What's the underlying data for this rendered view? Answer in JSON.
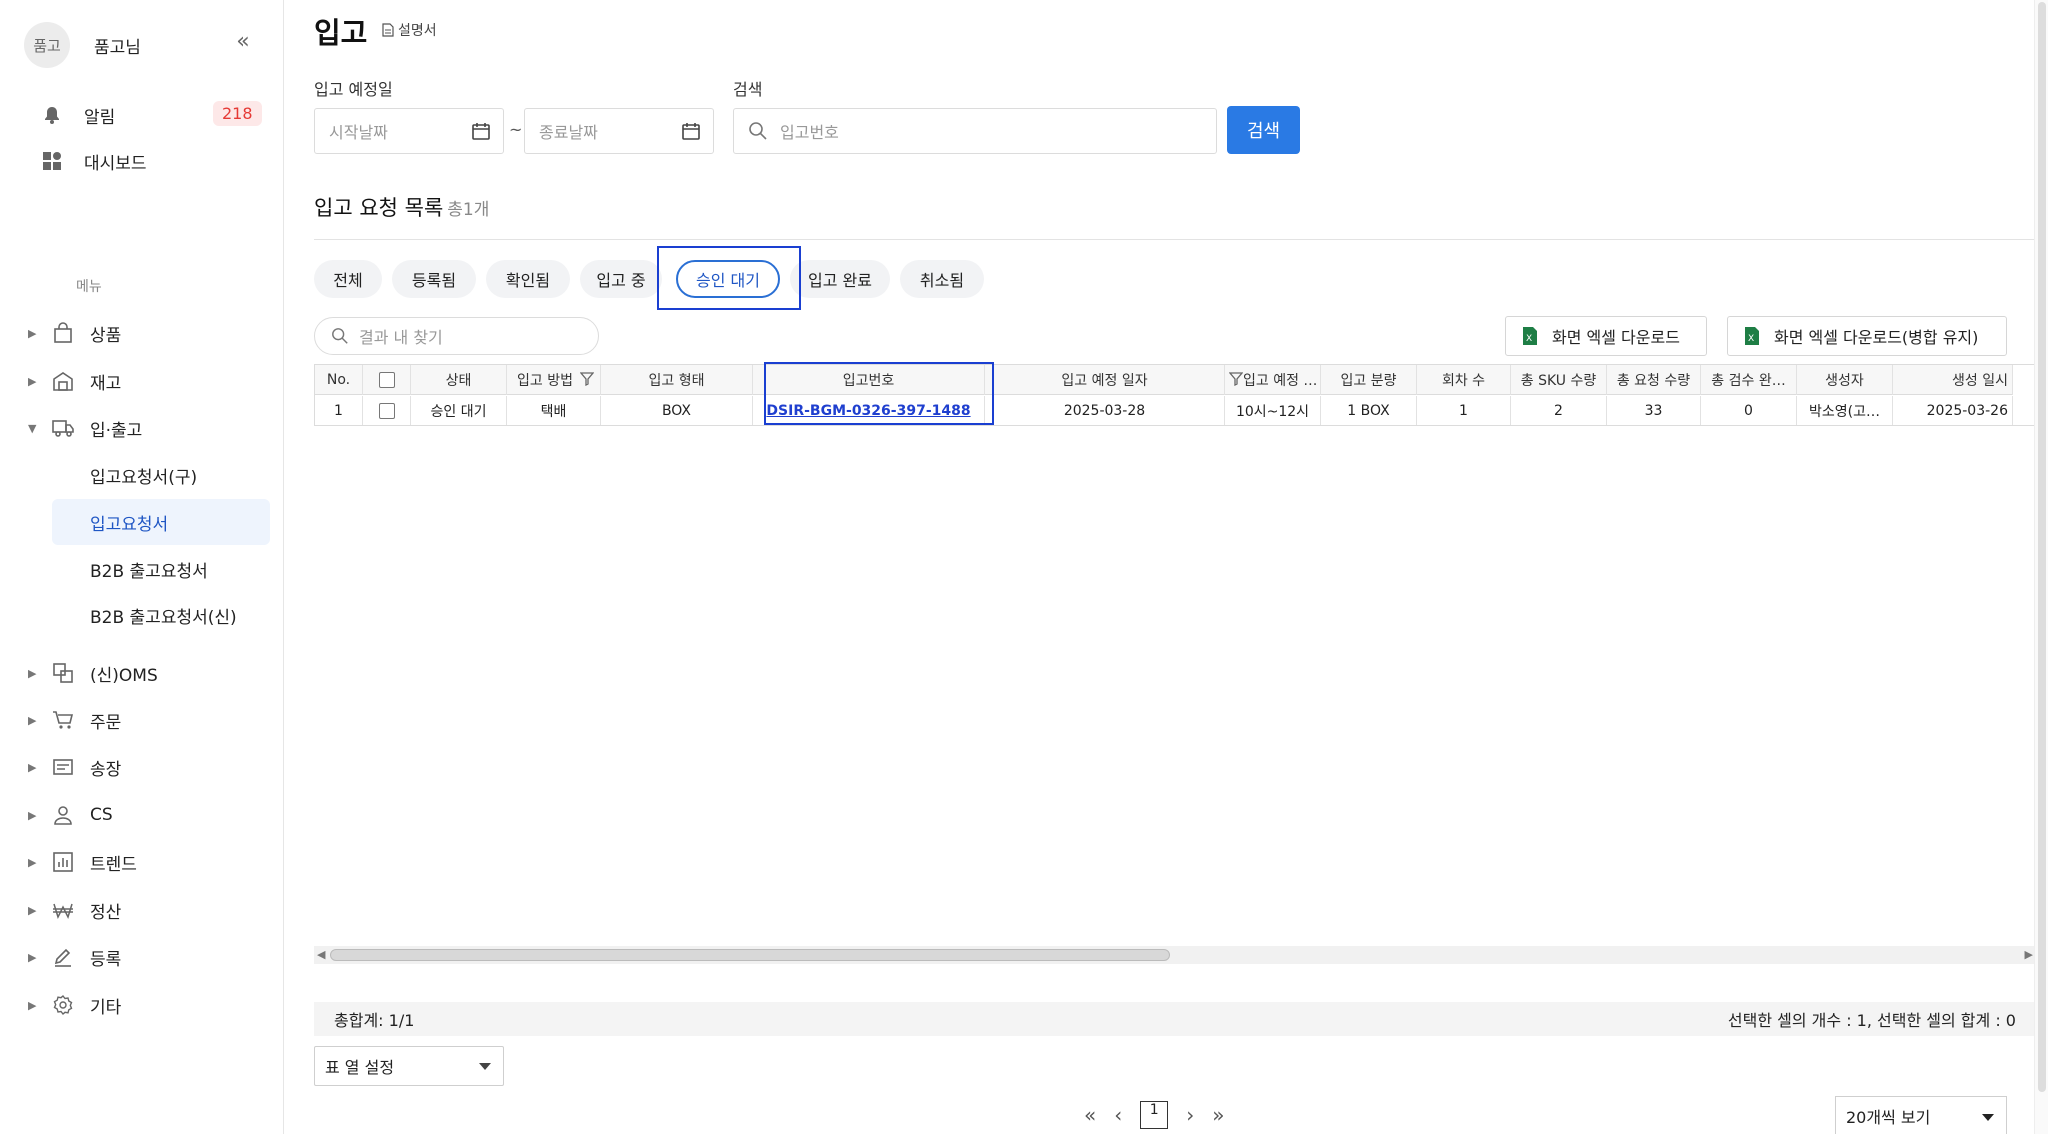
{
  "sidebar": {
    "avatar_text": "품고",
    "user_name": "품고님",
    "collapse_glyph": "«",
    "notifications_label": "알림",
    "notifications_count": "218",
    "dashboard_label": "대시보드",
    "menu_label": "메뉴",
    "nav": [
      {
        "label": "상품",
        "icon": "bag-icon"
      },
      {
        "label": "재고",
        "icon": "warehouse-icon"
      },
      {
        "label": "입·출고",
        "icon": "truck-icon"
      },
      {
        "label": "(신)OMS",
        "icon": "oms-icon"
      },
      {
        "label": "주문",
        "icon": "cart-icon"
      },
      {
        "label": "송장",
        "icon": "invoice-icon"
      },
      {
        "label": "CS",
        "icon": "user-icon"
      },
      {
        "label": "트렌드",
        "icon": "bar-chart-icon"
      },
      {
        "label": "정산",
        "icon": "won-icon"
      },
      {
        "label": "등록",
        "icon": "pen-icon"
      },
      {
        "label": "기타",
        "icon": "gear-icon"
      }
    ],
    "sub_items": [
      "입고요청서(구)",
      "입고요청서",
      "B2B 출고요청서",
      "B2B 출고요청서(신)"
    ]
  },
  "header": {
    "title": "입고",
    "manual_label": "설명서"
  },
  "filters": {
    "date_label": "입고 예정일",
    "start_placeholder": "시작날짜",
    "end_placeholder": "종료날짜",
    "tilde": "~",
    "search_label": "검색",
    "search_placeholder": "입고번호",
    "search_button": "검색"
  },
  "list": {
    "title": "입고 요청 목록",
    "count": "총1개",
    "tabs": [
      "전체",
      "등록됨",
      "확인됨",
      "입고 중",
      "승인 대기",
      "입고 완료",
      "취소됨"
    ],
    "selected_tab": "승인 대기",
    "find_placeholder": "결과 내 찾기",
    "excel_button": "화면 엑셀 다운로드",
    "excel_merge_button": "화면 엑셀 다운로드(병합 유지)"
  },
  "table": {
    "columns": [
      "No.",
      "",
      "상태",
      "입고 방법",
      "입고 형태",
      "입고번호",
      "입고 예정 일자",
      "입고 예정 …",
      "입고 분량",
      "회차 수",
      "총 SKU 수량",
      "총 요청 수량",
      "총 검수 완…",
      "생성자",
      "생성 일시"
    ],
    "rows": [
      [
        "1",
        "",
        "승인 대기",
        "택배",
        "BOX",
        "DSIR-BGM-0326-397-1488",
        "2025-03-28",
        "10시~12시",
        "1 BOX",
        "1",
        "2",
        "33",
        "0",
        "박소영(고…",
        "2025-03-26"
      ]
    ]
  },
  "footer": {
    "total": "총합계: 1/1",
    "selection_info": "선택한 셀의 개수 : 1, 선택한 셀의 합계 : 0",
    "column_setting": "표 열 설정",
    "page_current": "1",
    "page_size": "20개씩 보기"
  },
  "colors": {
    "accent": "#2a7ae4",
    "highlight_box": "#1a3fd1",
    "badge_text": "#e53935",
    "link": "#1f3fcf"
  }
}
